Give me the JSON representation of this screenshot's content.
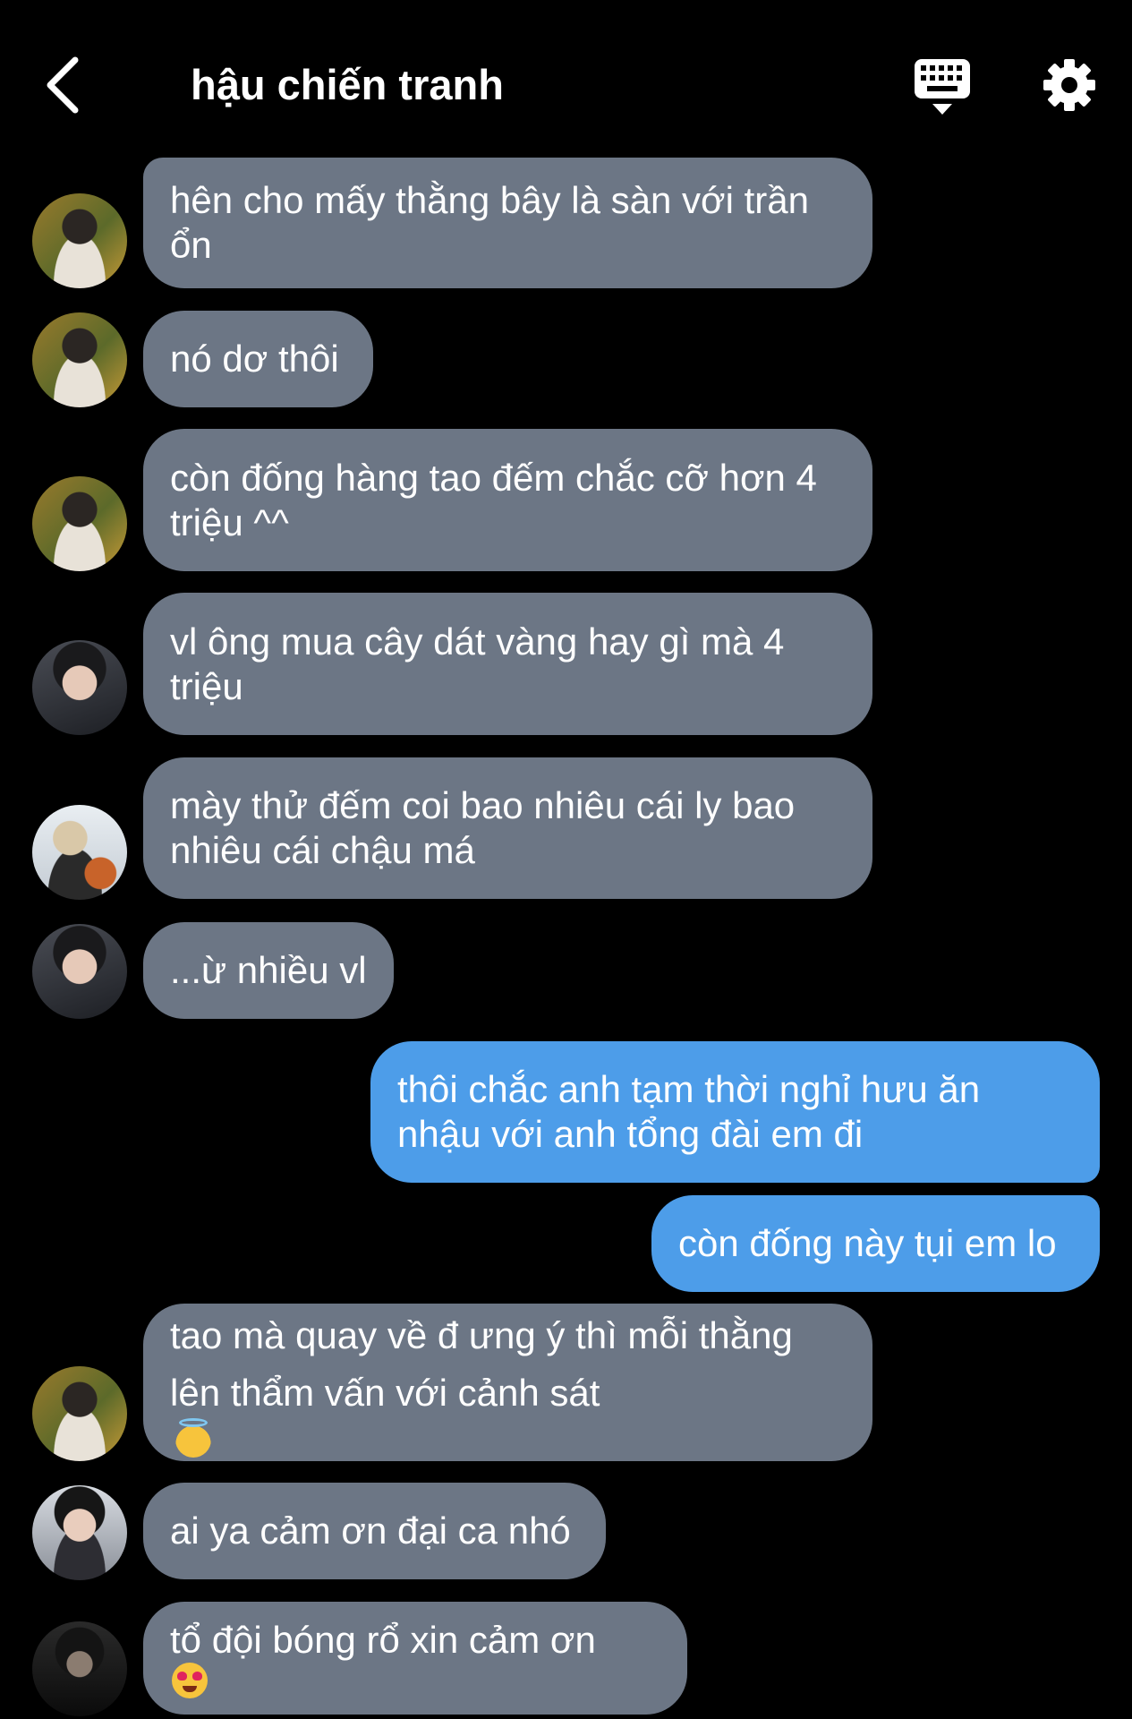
{
  "header": {
    "title": "hậu chiến tranh",
    "back_icon": "chevron-left-icon",
    "keyboard_icon": "keyboard-icon",
    "settings_icon": "gear-icon"
  },
  "colors": {
    "background": "#000000",
    "incoming_bubble": "#6c7685",
    "outgoing_bubble": "#4d9de9",
    "text": "#ffffff"
  },
  "messages": [
    {
      "direction": "incoming",
      "text": "hên cho mấy thằng bây là sàn với trần\nổn",
      "avatar": "avatar-a"
    },
    {
      "direction": "incoming",
      "text": "nó dơ thôi",
      "avatar": "avatar-a"
    },
    {
      "direction": "incoming",
      "text": "còn đống hàng tao đếm chắc cỡ hơn 4\ntriệu ^^",
      "avatar": "avatar-a"
    },
    {
      "direction": "incoming",
      "text": "vl ông mua cây dát vàng hay gì mà 4\ntriệu",
      "avatar": "avatar-b"
    },
    {
      "direction": "incoming",
      "text": "mày thử đếm coi bao nhiêu cái ly bao\nnhiêu cái chậu má",
      "avatar": "avatar-c"
    },
    {
      "direction": "incoming",
      "text": "...ừ nhiều vl",
      "avatar": "avatar-b"
    },
    {
      "direction": "outgoing",
      "text": "thôi chắc anh tạm thời nghỉ hưu ăn\nnhậu với anh tổng đài em đi"
    },
    {
      "direction": "outgoing",
      "text": "còn đống này tụi em lo"
    },
    {
      "direction": "incoming",
      "text": "tao mà quay về đ ưng ý thì mỗi thằng\nlên thẩm vấn với cảnh sát",
      "emoji": "smiling-face-with-halo-emoji",
      "avatar": "avatar-a"
    },
    {
      "direction": "incoming",
      "text": "ai ya cảm ơn đại ca nhó",
      "avatar": "avatar-d"
    },
    {
      "direction": "incoming",
      "text": "tổ đội bóng rổ xin cảm ơn",
      "emoji": "heart-eyes-emoji",
      "avatar": "avatar-e"
    }
  ]
}
